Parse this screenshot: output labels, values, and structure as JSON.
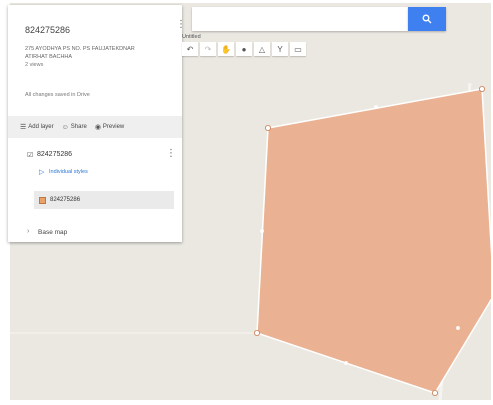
{
  "map": {
    "polygon": {
      "fill_color": "#eab292",
      "stroke_color": "#ffffff"
    }
  },
  "panel": {
    "title": "824275286",
    "subtitle_line1": "275 AYODHYA PS NO. PS FAUJATEKDNAR",
    "subtitle_line2": "ATIRHAT BACHHA",
    "views": "2 views",
    "saved_status": "All changes saved in Drive",
    "toolbar": {
      "add_layer": "Add layer",
      "share": "Share",
      "preview": "Preview"
    },
    "layer": {
      "name": "824275286",
      "styles_link": "Individual styles",
      "feature_name": "824275286"
    },
    "base_map": "Base map"
  },
  "search": {
    "value": "",
    "placeholder": ""
  },
  "draw_toolbar": {
    "label": "Untitled"
  },
  "icons": {
    "search": "search-icon",
    "kebab": "more-vert-icon"
  }
}
